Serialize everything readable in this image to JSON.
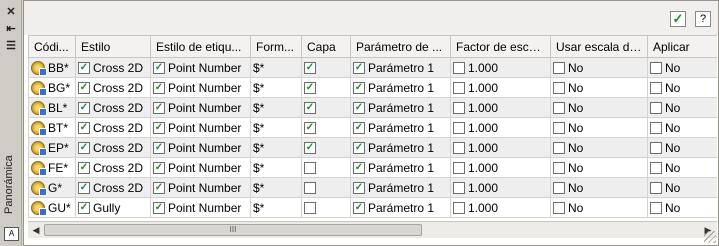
{
  "window": {
    "side_label": "Panorámica",
    "close_symbol": "✕",
    "autohide_symbol": "⇤",
    "properties_symbol": "☰",
    "bottom_icon_label": "A"
  },
  "toolbar": {
    "ok_symbol": "✓",
    "help_label": "?"
  },
  "columns": [
    "Códi...",
    "Estilo",
    "Estilo de etiqu...",
    "Form...",
    "Capa",
    "Parámetro de ...",
    "Factor de escal...",
    "Usar escala de ...",
    "Aplicar"
  ],
  "rows": [
    {
      "code": "BB*",
      "style": "Cross 2D",
      "label_style": "Point Number",
      "format": "$*",
      "layer": true,
      "param": "Parámetro 1",
      "factor": "1.000",
      "use_scale": "No",
      "apply": "No"
    },
    {
      "code": "BG*",
      "style": "Cross 2D",
      "label_style": "Point Number",
      "format": "$*",
      "layer": true,
      "param": "Parámetro 1",
      "factor": "1.000",
      "use_scale": "No",
      "apply": "No"
    },
    {
      "code": "BL*",
      "style": "Cross 2D",
      "label_style": "Point Number",
      "format": "$*",
      "layer": true,
      "param": "Parámetro 1",
      "factor": "1.000",
      "use_scale": "No",
      "apply": "No"
    },
    {
      "code": "BT*",
      "style": "Cross 2D",
      "label_style": "Point Number",
      "format": "$*",
      "layer": true,
      "param": "Parámetro 1",
      "factor": "1.000",
      "use_scale": "No",
      "apply": "No"
    },
    {
      "code": "EP*",
      "style": "Cross 2D",
      "label_style": "Point Number",
      "format": "$*",
      "layer": true,
      "param": "Parámetro 1",
      "factor": "1.000",
      "use_scale": "No",
      "apply": "No"
    },
    {
      "code": "FE*",
      "style": "Cross 2D",
      "label_style": "Point Number",
      "format": "$*",
      "layer": false,
      "param": "Parámetro 1",
      "factor": "1.000",
      "use_scale": "No",
      "apply": "No"
    },
    {
      "code": "G*",
      "style": "Cross 2D",
      "label_style": "Point Number",
      "format": "$*",
      "layer": false,
      "param": "Parámetro 1",
      "factor": "1.000",
      "use_scale": "No",
      "apply": "No"
    },
    {
      "code": "GU*",
      "style": "Gully",
      "label_style": "Point Number",
      "format": "$*",
      "layer": false,
      "param": "Parámetro 1",
      "factor": "1.000",
      "use_scale": "No",
      "apply": "No"
    }
  ],
  "scrollbar": {
    "left_arrow": "◀",
    "right_arrow": "▶",
    "thumb_grip": "III"
  }
}
